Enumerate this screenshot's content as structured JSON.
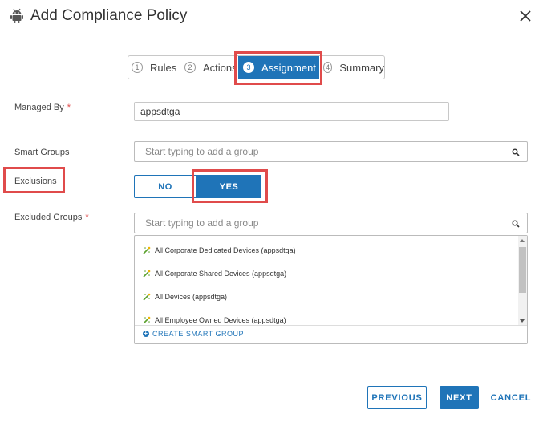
{
  "dialog": {
    "title": "Add Compliance Policy"
  },
  "wizard": {
    "steps": [
      {
        "num": "1",
        "label": "Rules"
      },
      {
        "num": "2",
        "label": "Actions"
      },
      {
        "num": "3",
        "label": "Assignment"
      },
      {
        "num": "4",
        "label": "Summary"
      }
    ],
    "active_step": 3
  },
  "form": {
    "managed_by": {
      "label": "Managed By",
      "required": "*",
      "value": "appsdtga"
    },
    "smart_groups": {
      "label": "Smart Groups",
      "placeholder": "Start typing to add a group"
    },
    "exclusions": {
      "label": "Exclusions",
      "options": [
        "NO",
        "YES"
      ],
      "selected": "YES"
    },
    "excluded_groups": {
      "label": "Excluded Groups",
      "required": "*",
      "placeholder": "Start typing to add a group",
      "options": [
        "All Corporate Dedicated Devices (appsdtga)",
        "All Corporate Shared Devices (appsdtga)",
        "All Devices (appsdtga)",
        "All Employee Owned Devices (appsdtga)"
      ],
      "create_label": "CREATE SMART GROUP"
    }
  },
  "footer": {
    "previous": "PREVIOUS",
    "next": "NEXT",
    "cancel": "CANCEL"
  },
  "colors": {
    "accent": "#1f74b8",
    "highlight": "#e04b4b"
  },
  "icons": {
    "platform": "android-icon",
    "close": "close-icon",
    "search": "search-icon",
    "group": "smart-group-icon"
  }
}
